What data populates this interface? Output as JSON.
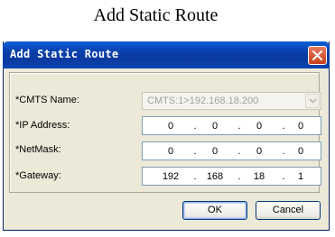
{
  "caption": "Add Static Route",
  "dialog": {
    "title": "Add Static Route",
    "close_icon": "close-icon",
    "cmts": {
      "label": "*CMTS Name:",
      "value": "CMTS:1>192.168.18.200",
      "disabled": true
    },
    "ip_address": {
      "label": "*IP Address:",
      "octets": [
        "0",
        "0",
        "0",
        "0"
      ]
    },
    "netmask": {
      "label": "*NetMask:",
      "octets": [
        "0",
        "0",
        "0",
        "0"
      ]
    },
    "gateway": {
      "label": "*Gateway:",
      "octets": [
        "192",
        "168",
        "18",
        "1"
      ]
    },
    "ok_label": "OK",
    "cancel_label": "Cancel"
  },
  "colors": {
    "title_bar": "#0a3ea8",
    "dialog_bg": "#ece9d8",
    "close_button": "#c8401e"
  }
}
